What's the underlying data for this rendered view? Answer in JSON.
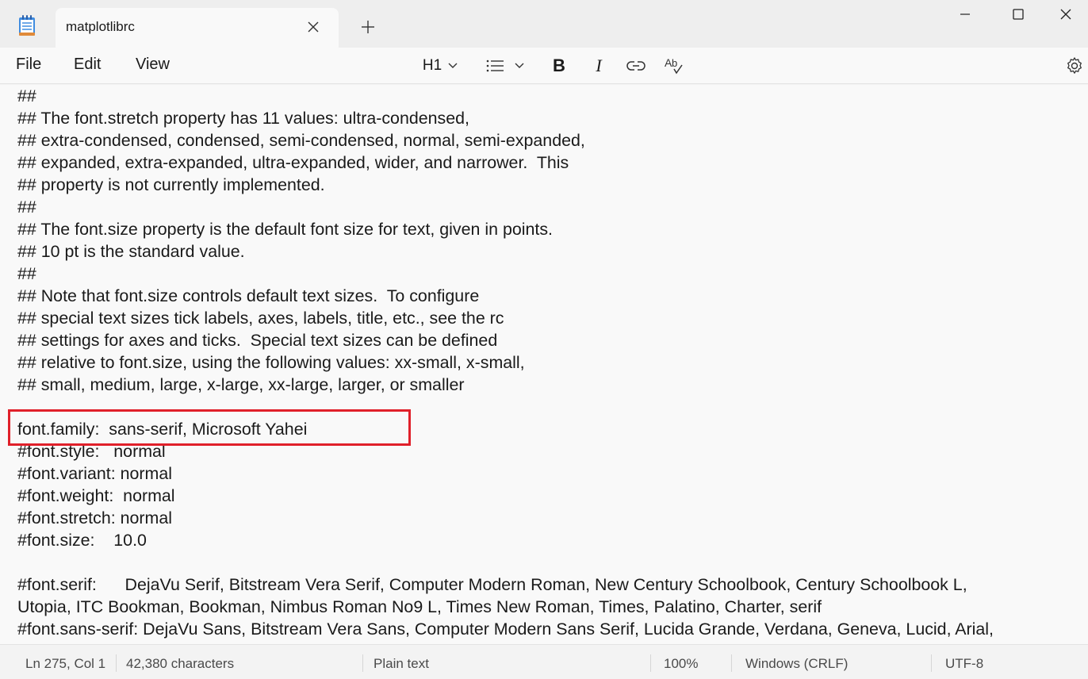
{
  "window": {
    "tab_title": "matplotlibrc",
    "new_tab_symbol": "+"
  },
  "menu": {
    "file": "File",
    "edit": "Edit",
    "view": "View"
  },
  "toolbar": {
    "heading": "H1",
    "bold": "B",
    "italic": "I"
  },
  "editor": {
    "lines": [
      "##",
      "## The font.stretch property has 11 values: ultra-condensed,",
      "## extra-condensed, condensed, semi-condensed, normal, semi-expanded,",
      "## expanded, extra-expanded, ultra-expanded, wider, and narrower.  This",
      "## property is not currently implemented.",
      "##",
      "## The font.size property is the default font size for text, given in points.",
      "## 10 pt is the standard value.",
      "##",
      "## Note that font.size controls default text sizes.  To configure",
      "## special text sizes tick labels, axes, labels, title, etc., see the rc",
      "## settings for axes and ticks.  Special text sizes can be defined",
      "## relative to font.size, using the following values: xx-small, x-small,",
      "## small, medium, large, x-large, xx-large, larger, or smaller",
      "",
      "font.family:  sans-serif, Microsoft Yahei",
      "#font.style:   normal",
      "#font.variant: normal",
      "#font.weight:  normal",
      "#font.stretch: normal",
      "#font.size:    10.0",
      "",
      "#font.serif:      DejaVu Serif, Bitstream Vera Serif, Computer Modern Roman, New Century Schoolbook, Century Schoolbook L,",
      "Utopia, ITC Bookman, Bookman, Nimbus Roman No9 L, Times New Roman, Times, Palatino, Charter, serif",
      "#font.sans-serif: DejaVu Sans, Bitstream Vera Sans, Computer Modern Sans Serif, Lucida Grande, Verdana, Geneva, Lucid, Arial,"
    ],
    "highlight_color": "#e0202a"
  },
  "status": {
    "position": "Ln 275, Col 1",
    "characters": "42,380 characters",
    "format": "Plain text",
    "zoom": "100%",
    "line_ending": "Windows (CRLF)",
    "encoding": "UTF-8"
  },
  "icons": {
    "app": "notepad-icon",
    "close_tab": "close-icon",
    "minimize": "minimize-icon",
    "maximize": "maximize-icon",
    "close_window": "close-icon",
    "list": "bulleted-list-icon",
    "link": "link-icon",
    "spell": "spellcheck-icon",
    "settings": "gear-icon"
  },
  "colors": {
    "accent": "#3b7dd8",
    "highlight": "#e0202a"
  }
}
